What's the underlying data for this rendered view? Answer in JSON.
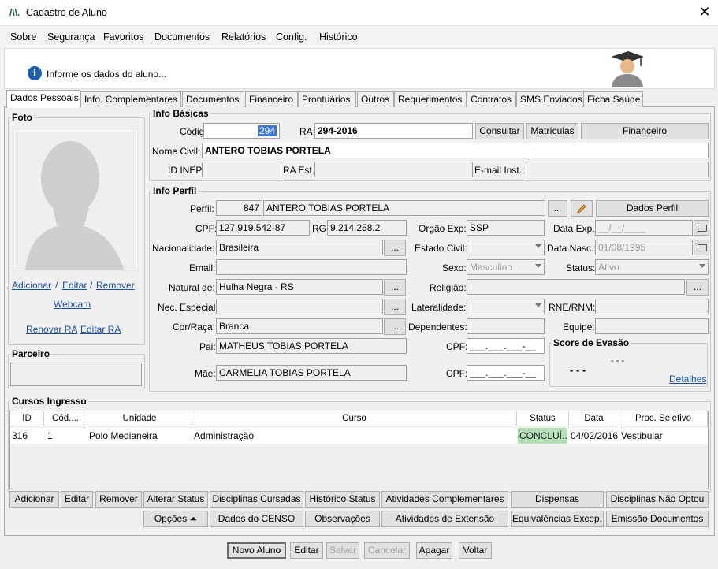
{
  "window": {
    "title": "Cadastro de Aluno"
  },
  "menu": [
    "Sobre",
    "Segurança",
    "Favoritos",
    "Documentos",
    "Relatórios",
    "Config.",
    "Histórico"
  ],
  "header": {
    "info": "Informe os dados do aluno..."
  },
  "tabs": [
    "Dados Pessoais",
    "Info. Complementares",
    "Documentos",
    "Financeiro",
    "Prontuários",
    "Outros",
    "Requerimentos",
    "Contratos",
    "SMS Enviados",
    "Ficha Saúde"
  ],
  "foto": {
    "legend": "Foto",
    "adicionar": "Adicionar",
    "editar": "Editar",
    "remover": "Remover",
    "sep": "/",
    "webcam": "Webcam",
    "renovar_ra": "Renovar RA",
    "editar_ra": "Editar RA"
  },
  "parceiro": {
    "legend": "Parceiro"
  },
  "basicas": {
    "legend": "Info Básicas",
    "codigo_label": "Código:",
    "codigo": "294",
    "ra_label": "RA:",
    "ra": "294-2016",
    "consultar": "Consultar",
    "matriculas": "Matrículas",
    "financeiro": "Financeiro",
    "nome_label": "Nome Civil:",
    "nome": "ANTERO TOBIAS PORTELA",
    "inep_label": "ID INEP:",
    "ra_est_label": "RA Est.:",
    "email_inst_label": "E-mail Inst.:"
  },
  "perfil": {
    "legend": "Info Perfil",
    "perfil_label": "Perfil:",
    "perfil_id": "847",
    "perfil_nome": "ANTERO TOBIAS PORTELA",
    "ellipsis": "...",
    "dados_perfil": "Dados Perfil",
    "cpf_label": "CPF:",
    "cpf": "127.919.542-87",
    "rg_label": "RG:",
    "rg": "9.214.258.2",
    "orgao_label": "Orgão Exp:",
    "orgao": "SSP",
    "data_exp_label": "Data Exp.:",
    "data_exp": "__/__/____",
    "nac_label": "Nacionalidade:",
    "nac": "Brasileira",
    "civil_label": "Estado Civil:",
    "nasc_label": "Data Nasc.:",
    "nasc": "01/08/1995",
    "email_label": "Email:",
    "sexo_label": "Sexo:",
    "sexo": "Masculino",
    "status_label": "Status:",
    "status": "Ativo",
    "natural_label": "Natural de:",
    "natural": "Hulha Negra - RS",
    "religiao_label": "Religião:",
    "nec_label": "Nec. Especial:",
    "lateral_label": "Lateralidade:",
    "rne_label": "RNE/RNM:",
    "cor_label": "Cor/Raça:",
    "cor": "Branca",
    "dep_label": "Dependentes:",
    "equipe_label": "Equipe:",
    "pai_label": "Pai:",
    "pai": "MATHEUS TOBIAS PORTELA",
    "cpf_pai_label": "CPF:",
    "cpf_mask": "___.___.___-__",
    "mae_label": "Mãe:",
    "mae": "CARMELIA TOBIAS PORTELA",
    "cpf_mae_label": "CPF:"
  },
  "evasao": {
    "legend": "Score de Evasão",
    "value": "- - -",
    "small": "- - -",
    "detalhes": "Detalhes"
  },
  "cursos": {
    "legend": "Cursos Ingresso",
    "columns": [
      "ID",
      "Cód....",
      "Unidade",
      "Curso",
      "Status",
      "Data",
      "Proc. Seletivo"
    ],
    "row": [
      "316",
      "1",
      "Polo Medianeira",
      "Administração",
      "CONCLUÍ...",
      "04/02/2016",
      "Vestibular"
    ]
  },
  "actions1": [
    "Adicionar",
    "Editar",
    "Remover",
    "Alterar Status",
    "Disciplinas Cursadas",
    "Histórico Status",
    "Atividades Complementares",
    "Dispensas",
    "Disciplinas Não Optou"
  ],
  "actions2": [
    "Opções ⏶",
    "Dados do CENSO",
    "Observações",
    "Atividades de Extensão",
    "Equivalências Excep.",
    "Emissão Documentos"
  ],
  "bottom": [
    "Novo Aluno",
    "Editar",
    "Salvar",
    "Cancelar",
    "Apagar",
    "Voltar"
  ]
}
